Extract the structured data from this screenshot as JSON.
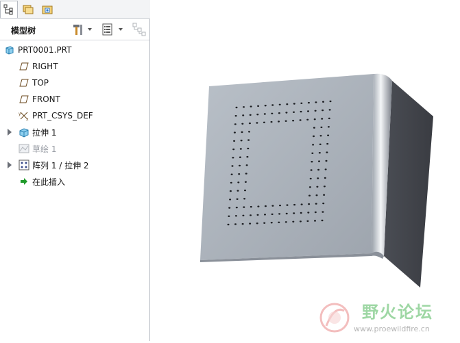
{
  "colors": {
    "accent": "#2d7ad6",
    "sheet": "#a9b0b9",
    "sheet_dark": "#4b4e56",
    "watermark": "#9ed7a4"
  },
  "tabs": [
    {
      "name": "tab-model-tree",
      "icon": "tree-icon",
      "active": true
    },
    {
      "name": "tab-folder-browser",
      "icon": "folders-icon",
      "active": false
    },
    {
      "name": "tab-favorites",
      "icon": "star-folder-icon",
      "active": false
    }
  ],
  "panel": {
    "title": "模型树",
    "tools": [
      "tools-icon",
      "dropdown-arrow-icon",
      "list-settings-icon",
      "dropdown-arrow-icon",
      "filter-icon"
    ]
  },
  "tree": {
    "root": {
      "label": "PRT0001.PRT",
      "icon": "part-icon"
    },
    "items": [
      {
        "label": "RIGHT",
        "icon": "datum-plane-icon",
        "dim": false,
        "expandable": false
      },
      {
        "label": "TOP",
        "icon": "datum-plane-icon",
        "dim": false,
        "expandable": false
      },
      {
        "label": "FRONT",
        "icon": "datum-plane-icon",
        "dim": false,
        "expandable": false
      },
      {
        "label": "PRT_CSYS_DEF",
        "icon": "csys-icon",
        "dim": false,
        "expandable": false
      },
      {
        "label": "拉伸 1",
        "icon": "extrude-icon",
        "dim": false,
        "expandable": true
      },
      {
        "label": "草绘 1",
        "icon": "sketch-icon",
        "dim": true,
        "expandable": false
      },
      {
        "label": "阵列 1 / 拉伸 2",
        "icon": "pattern-icon",
        "dim": false,
        "expandable": true
      },
      {
        "label": "在此插入",
        "icon": "insert-arrow-icon",
        "dim": false,
        "expandable": false
      }
    ]
  },
  "watermark": {
    "title": "野火论坛",
    "url": "www.proewildfire.cn"
  }
}
